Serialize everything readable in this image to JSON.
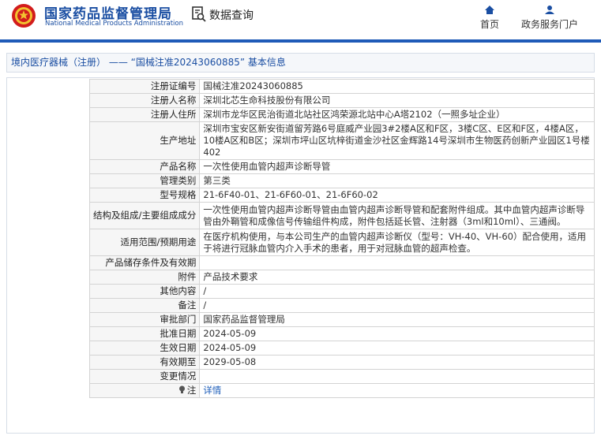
{
  "header": {
    "logo_cn": "国家药品监督管理局",
    "logo_en": "National Medical Products Administration",
    "query": "数据查询",
    "nav": [
      {
        "label": "首页"
      },
      {
        "label": "政务服务门户"
      }
    ]
  },
  "breadcrumb": {
    "category": "境内医疗器械（注册）",
    "sep": "——",
    "tail": "“国械注准20243060885” 基本信息"
  },
  "rows": [
    {
      "key": "注册证编号",
      "value": "国械注准20243060885"
    },
    {
      "key": "注册人名称",
      "value": "深圳北芯生命科技股份有限公司"
    },
    {
      "key": "注册人住所",
      "value": "深圳市龙华区民治街道北站社区鸿荣源北站中心A塔2102（一照多址企业）"
    },
    {
      "key": "生产地址",
      "value": "深圳市宝安区新安街道留芳路6号庭威产业园3#2楼A区和F区，3楼C区、E区和F区，4楼A区，10楼A区和B区；深圳市坪山区坑梓街道金沙社区金辉路14号深圳市生物医药创新产业园区1号楼402"
    },
    {
      "key": "产品名称",
      "value": "一次性使用血管内超声诊断导管"
    },
    {
      "key": "管理类别",
      "value": "第三类"
    },
    {
      "key": "型号规格",
      "value": "21-6F40-01、21-6F60-01、21-6F60-02"
    },
    {
      "key": "结构及组成/主要组成成分",
      "value": "一次性使用血管内超声诊断导管由血管内超声诊断导管和配套附件组成。其中血管内超声诊断导管由外鞘管和成像信号传输组件构成，附件包括延长管、注射器（3ml和10ml）、三通阀。"
    },
    {
      "key": "适用范围/预期用途",
      "value": "在医疗机构使用，与本公司生产的血管内超声诊断仪（型号：VH-40、VH-60）配合使用，适用于将进行冠脉血管内介入手术的患者，用于对冠脉血管的超声检查。"
    },
    {
      "key": "产品储存条件及有效期",
      "value": ""
    },
    {
      "key": "附件",
      "value": "产品技术要求"
    },
    {
      "key": "其他内容",
      "value": "/"
    },
    {
      "key": "备注",
      "value": "/"
    },
    {
      "key": "审批部门",
      "value": "国家药品监督管理局"
    },
    {
      "key": "批准日期",
      "value": "2024-05-09"
    },
    {
      "key": "生效日期",
      "value": "2024-05-09"
    },
    {
      "key": "有效期至",
      "value": "2029-05-08"
    },
    {
      "key": "变更情况",
      "value": ""
    },
    {
      "key": "注",
      "value": "详情"
    }
  ]
}
